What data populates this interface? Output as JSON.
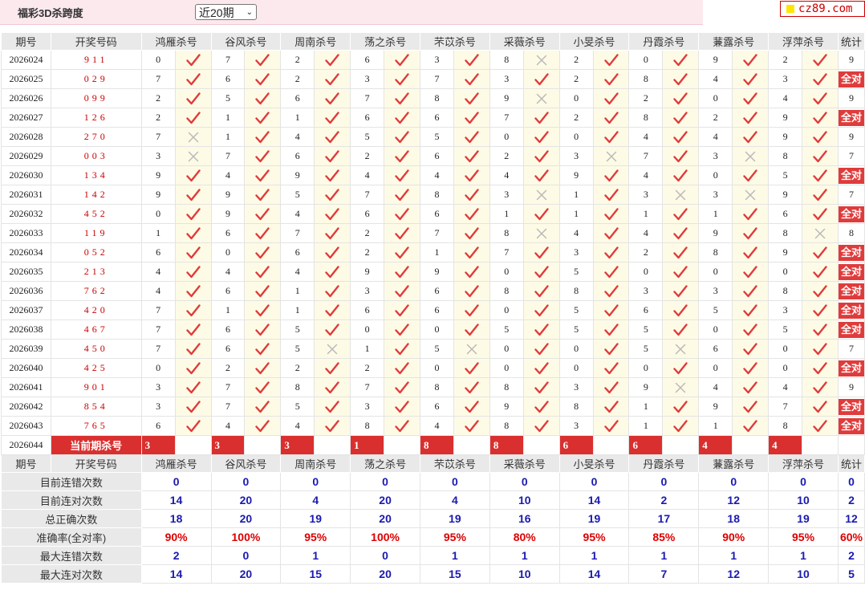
{
  "page": {
    "title": "福彩3D杀跨度",
    "period_select": "近20期",
    "logo_text": "cz89.com"
  },
  "colors": {
    "accent": "#d9302f",
    "check": "#e03b3b",
    "stat_blue": "#1a1ab0",
    "header_bg": "#e9e9e9"
  },
  "headers": [
    "期号",
    "开奖号码",
    "鸿雁杀号",
    "谷风杀号",
    "周南杀号",
    "荡之杀号",
    "芣苡杀号",
    "采薇杀号",
    "小旻杀号",
    "丹霞杀号",
    "蒹露杀号",
    "浮萍杀号",
    "统计"
  ],
  "rows": [
    {
      "issue": "2026024",
      "draw": "911",
      "picks": [
        "0",
        "7",
        "2",
        "6",
        "3",
        "8",
        "2",
        "0",
        "9",
        "2"
      ],
      "ok": [
        1,
        1,
        1,
        1,
        1,
        0,
        1,
        1,
        1,
        1
      ],
      "stat": "9"
    },
    {
      "issue": "2026025",
      "draw": "029",
      "picks": [
        "7",
        "6",
        "2",
        "3",
        "7",
        "3",
        "2",
        "8",
        "4",
        "3"
      ],
      "ok": [
        1,
        1,
        1,
        1,
        1,
        1,
        1,
        1,
        1,
        1
      ],
      "stat": "全对"
    },
    {
      "issue": "2026026",
      "draw": "099",
      "picks": [
        "2",
        "5",
        "6",
        "7",
        "8",
        "9",
        "0",
        "2",
        "0",
        "4"
      ],
      "ok": [
        1,
        1,
        1,
        1,
        1,
        0,
        1,
        1,
        1,
        1
      ],
      "stat": "9"
    },
    {
      "issue": "2026027",
      "draw": "126",
      "picks": [
        "2",
        "1",
        "1",
        "6",
        "6",
        "7",
        "2",
        "8",
        "2",
        "9"
      ],
      "ok": [
        1,
        1,
        1,
        1,
        1,
        1,
        1,
        1,
        1,
        1
      ],
      "stat": "全对"
    },
    {
      "issue": "2026028",
      "draw": "270",
      "picks": [
        "7",
        "1",
        "4",
        "5",
        "5",
        "0",
        "0",
        "4",
        "4",
        "9"
      ],
      "ok": [
        0,
        1,
        1,
        1,
        1,
        1,
        1,
        1,
        1,
        1
      ],
      "stat": "9"
    },
    {
      "issue": "2026029",
      "draw": "003",
      "picks": [
        "3",
        "7",
        "6",
        "2",
        "6",
        "2",
        "3",
        "7",
        "3",
        "8"
      ],
      "ok": [
        0,
        1,
        1,
        1,
        1,
        1,
        0,
        1,
        0,
        1
      ],
      "stat": "7"
    },
    {
      "issue": "2026030",
      "draw": "134",
      "picks": [
        "9",
        "4",
        "9",
        "4",
        "4",
        "4",
        "9",
        "4",
        "0",
        "5"
      ],
      "ok": [
        1,
        1,
        1,
        1,
        1,
        1,
        1,
        1,
        1,
        1
      ],
      "stat": "全对"
    },
    {
      "issue": "2026031",
      "draw": "142",
      "picks": [
        "9",
        "9",
        "5",
        "7",
        "8",
        "3",
        "1",
        "3",
        "3",
        "9"
      ],
      "ok": [
        1,
        1,
        1,
        1,
        1,
        0,
        1,
        0,
        0,
        1
      ],
      "stat": "7"
    },
    {
      "issue": "2026032",
      "draw": "452",
      "picks": [
        "0",
        "9",
        "4",
        "6",
        "6",
        "1",
        "1",
        "1",
        "1",
        "6"
      ],
      "ok": [
        1,
        1,
        1,
        1,
        1,
        1,
        1,
        1,
        1,
        1
      ],
      "stat": "全对"
    },
    {
      "issue": "2026033",
      "draw": "119",
      "picks": [
        "1",
        "6",
        "7",
        "2",
        "7",
        "8",
        "4",
        "4",
        "9",
        "8"
      ],
      "ok": [
        1,
        1,
        1,
        1,
        1,
        0,
        1,
        1,
        1,
        0
      ],
      "stat": "8"
    },
    {
      "issue": "2026034",
      "draw": "052",
      "picks": [
        "6",
        "0",
        "6",
        "2",
        "1",
        "7",
        "3",
        "2",
        "8",
        "9"
      ],
      "ok": [
        1,
        1,
        1,
        1,
        1,
        1,
        1,
        1,
        1,
        1
      ],
      "stat": "全对"
    },
    {
      "issue": "2026035",
      "draw": "213",
      "picks": [
        "4",
        "4",
        "4",
        "9",
        "9",
        "0",
        "5",
        "0",
        "0",
        "0"
      ],
      "ok": [
        1,
        1,
        1,
        1,
        1,
        1,
        1,
        1,
        1,
        1
      ],
      "stat": "全对"
    },
    {
      "issue": "2026036",
      "draw": "762",
      "picks": [
        "4",
        "6",
        "1",
        "3",
        "6",
        "8",
        "8",
        "3",
        "3",
        "8"
      ],
      "ok": [
        1,
        1,
        1,
        1,
        1,
        1,
        1,
        1,
        1,
        1
      ],
      "stat": "全对"
    },
    {
      "issue": "2026037",
      "draw": "420",
      "picks": [
        "7",
        "1",
        "1",
        "6",
        "6",
        "0",
        "5",
        "6",
        "5",
        "3"
      ],
      "ok": [
        1,
        1,
        1,
        1,
        1,
        1,
        1,
        1,
        1,
        1
      ],
      "stat": "全对"
    },
    {
      "issue": "2026038",
      "draw": "467",
      "picks": [
        "7",
        "6",
        "5",
        "0",
        "0",
        "5",
        "5",
        "5",
        "0",
        "5"
      ],
      "ok": [
        1,
        1,
        1,
        1,
        1,
        1,
        1,
        1,
        1,
        1
      ],
      "stat": "全对"
    },
    {
      "issue": "2026039",
      "draw": "450",
      "picks": [
        "7",
        "6",
        "5",
        "1",
        "5",
        "0",
        "0",
        "5",
        "6",
        "0"
      ],
      "ok": [
        1,
        1,
        0,
        1,
        0,
        1,
        1,
        0,
        1,
        1
      ],
      "stat": "7"
    },
    {
      "issue": "2026040",
      "draw": "425",
      "picks": [
        "0",
        "2",
        "2",
        "2",
        "0",
        "0",
        "0",
        "0",
        "0",
        "0"
      ],
      "ok": [
        1,
        1,
        1,
        1,
        1,
        1,
        1,
        1,
        1,
        1
      ],
      "stat": "全对"
    },
    {
      "issue": "2026041",
      "draw": "901",
      "picks": [
        "3",
        "7",
        "8",
        "7",
        "8",
        "8",
        "3",
        "9",
        "4",
        "4"
      ],
      "ok": [
        1,
        1,
        1,
        1,
        1,
        1,
        1,
        0,
        1,
        1
      ],
      "stat": "9"
    },
    {
      "issue": "2026042",
      "draw": "854",
      "picks": [
        "3",
        "7",
        "5",
        "3",
        "6",
        "9",
        "8",
        "1",
        "9",
        "7"
      ],
      "ok": [
        1,
        1,
        1,
        1,
        1,
        1,
        1,
        1,
        1,
        1
      ],
      "stat": "全对"
    },
    {
      "issue": "2026043",
      "draw": "765",
      "picks": [
        "6",
        "4",
        "4",
        "8",
        "4",
        "8",
        "3",
        "1",
        "1",
        "8"
      ],
      "ok": [
        1,
        1,
        1,
        1,
        1,
        1,
        1,
        1,
        1,
        1
      ],
      "stat": "全对"
    }
  ],
  "current": {
    "issue": "2026044",
    "label": "当前期杀号",
    "picks": [
      "3",
      "3",
      "3",
      "1",
      "8",
      "8",
      "6",
      "6",
      "4",
      "4"
    ]
  },
  "stats": [
    {
      "label": "目前连错次数",
      "values": [
        "0",
        "0",
        "0",
        "0",
        "0",
        "0",
        "0",
        "0",
        "0",
        "0",
        "0"
      ],
      "red": false
    },
    {
      "label": "目前连对次数",
      "values": [
        "14",
        "20",
        "4",
        "20",
        "4",
        "10",
        "14",
        "2",
        "12",
        "10",
        "2"
      ],
      "red": false
    },
    {
      "label": "总正确次数",
      "values": [
        "18",
        "20",
        "19",
        "20",
        "19",
        "16",
        "19",
        "17",
        "18",
        "19",
        "12"
      ],
      "red": false
    },
    {
      "label": "准确率(全对率)",
      "values": [
        "90%",
        "100%",
        "95%",
        "100%",
        "95%",
        "80%",
        "95%",
        "85%",
        "90%",
        "95%",
        "60%"
      ],
      "red": true
    },
    {
      "label": "最大连错次数",
      "values": [
        "2",
        "0",
        "1",
        "0",
        "1",
        "1",
        "1",
        "1",
        "1",
        "1",
        "2"
      ],
      "red": false
    },
    {
      "label": "最大连对次数",
      "values": [
        "14",
        "20",
        "15",
        "20",
        "15",
        "10",
        "14",
        "7",
        "12",
        "10",
        "5"
      ],
      "red": false
    }
  ]
}
